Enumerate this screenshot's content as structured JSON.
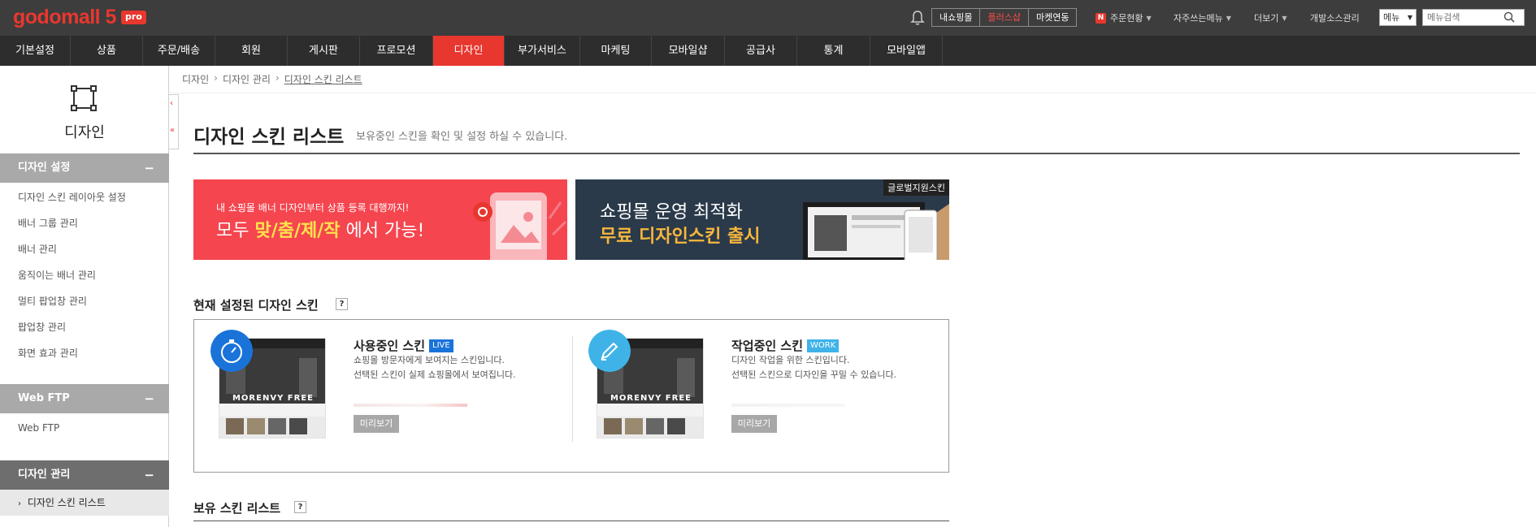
{
  "brand": {
    "logo_text": "godomall 5",
    "logo_badge": "pro",
    "accent": "#e8372f"
  },
  "top_links": {
    "segments": [
      "내쇼핑몰",
      "플러스샵",
      "마켓연동"
    ],
    "order_status": "주문현황",
    "favorites": "자주쓰는메뉴",
    "more": "더보기",
    "opensource": "개발소스관리",
    "menu_select": "메뉴",
    "search_placeholder": "메뉴검색"
  },
  "main_menu": [
    "기본설정",
    "상품",
    "주문/배송",
    "회원",
    "게시판",
    "프로모션",
    "디자인",
    "부가서비스",
    "마케팅",
    "모바일샵",
    "공급사",
    "통계",
    "모바일앱"
  ],
  "sidebar": {
    "title": "디자인",
    "sections": [
      {
        "label": "디자인 설정",
        "items": [
          "디자인 스킨 레이아웃 설정",
          "배너 그룹 관리",
          "배너 관리",
          "움직이는 배너 관리",
          "멀티 팝업창 관리",
          "팝업창 관리",
          "화면 효과 관리"
        ]
      },
      {
        "label": "Web FTP",
        "items": [
          "Web FTP"
        ]
      },
      {
        "label": "디자인 관리",
        "items": [
          "디자인 스킨 리스트"
        ]
      }
    ]
  },
  "breadcrumb": [
    "디자인",
    "디자인 관리",
    "디자인 스킨 리스트"
  ],
  "page": {
    "title": "디자인 스킨 리스트",
    "description": "보유중인 스킨을 확인 및 설정 하실 수 있습니다."
  },
  "banners": {
    "left": {
      "line1": "내 쇼핑몰 배너 디자인부터 상품 등록 대행까지!",
      "line2_prefix": "모두 ",
      "line2_highlight": "맞/춤/제/작",
      "line2_suffix": " 에서 가능!"
    },
    "right": {
      "badge": "글로벌지원스킨",
      "line1": "쇼핑몰 운영 최적화",
      "line2": "무료 디자인스킨 출시"
    }
  },
  "current_skin": {
    "section_title": "현재 설정된 디자인 스킨",
    "help": "?",
    "live": {
      "name": "사용중인 스킨",
      "badge": "LIVE",
      "badge_color": "#1a73d9",
      "desc1": "쇼핑몰 방문자에게 보여지는 스킨입니다.",
      "desc2": "선택된 스킨이 실제 쇼핑몰에서 보여집니다.",
      "preview": "미리보기",
      "thumb_label": "MORENVY FREE"
    },
    "work": {
      "name": "작업중인 스킨",
      "badge": "WORK",
      "badge_color": "#3fb3e8",
      "desc1": "디자인 작업을 위한 스킨입니다.",
      "desc2": "선택된 스킨으로 디자인을 꾸밀 수 있습니다.",
      "preview": "미리보기",
      "thumb_label": "MORENVY FREE"
    }
  },
  "owned_skins": {
    "section_title": "보유 스킨 리스트",
    "help": "?"
  }
}
